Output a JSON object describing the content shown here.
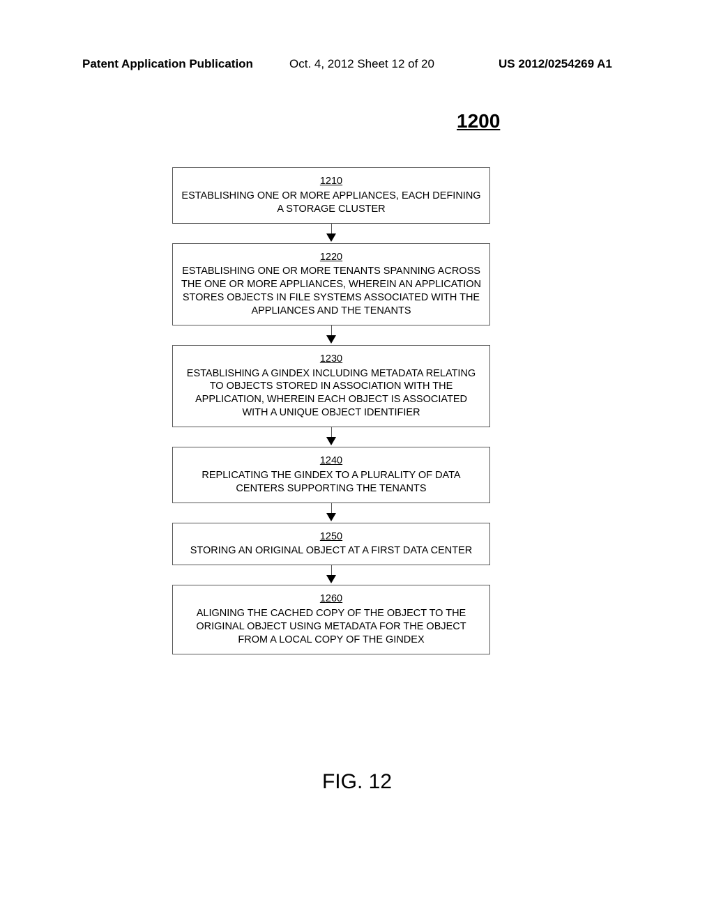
{
  "header": {
    "left": "Patent Application Publication",
    "center": "Oct. 4, 2012  Sheet 12 of 20",
    "right": "US 2012/0254269 A1"
  },
  "figure_number": "1200",
  "boxes": [
    {
      "ref": "1210",
      "text": "ESTABLISHING ONE OR MORE APPLIANCES, EACH DEFINING A STORAGE CLUSTER"
    },
    {
      "ref": "1220",
      "text": "ESTABLISHING ONE OR MORE TENANTS SPANNING ACROSS THE ONE OR MORE APPLIANCES, WHEREIN AN APPLICATION STORES OBJECTS IN FILE SYSTEMS ASSOCIATED WITH THE APPLIANCES AND THE TENANTS"
    },
    {
      "ref": "1230",
      "text": "ESTABLISHING A GINDEX INCLUDING METADATA RELATING TO OBJECTS STORED IN ASSOCIATION WITH THE APPLICATION, WHEREIN EACH OBJECT IS ASSOCIATED WITH A UNIQUE OBJECT IDENTIFIER"
    },
    {
      "ref": "1240",
      "text": "REPLICATING THE GINDEX TO A PLURALITY OF DATA CENTERS SUPPORTING THE TENANTS"
    },
    {
      "ref": "1250",
      "text": "STORING AN ORIGINAL OBJECT AT A FIRST DATA CENTER"
    },
    {
      "ref": "1260",
      "text": "ALIGNING THE CACHED COPY OF THE OBJECT TO THE ORIGINAL OBJECT USING METADATA FOR THE OBJECT FROM A LOCAL COPY OF THE GINDEX"
    }
  ],
  "figure_label": "FIG. 12"
}
